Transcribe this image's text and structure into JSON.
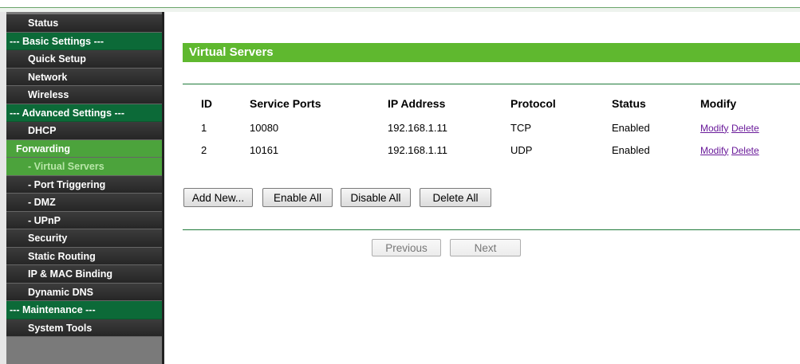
{
  "sidebar": {
    "items": [
      {
        "label": "Status",
        "kind": "item"
      },
      {
        "label": "--- Basic Settings ---",
        "kind": "section"
      },
      {
        "label": "Quick Setup",
        "kind": "item"
      },
      {
        "label": "Network",
        "kind": "item"
      },
      {
        "label": "Wireless",
        "kind": "item"
      },
      {
        "label": "--- Advanced Settings ---",
        "kind": "section"
      },
      {
        "label": "DHCP",
        "kind": "item"
      },
      {
        "label": "Forwarding",
        "kind": "active"
      },
      {
        "label": "- Virtual Servers",
        "kind": "current"
      },
      {
        "label": "- Port Triggering",
        "kind": "item"
      },
      {
        "label": "- DMZ",
        "kind": "item"
      },
      {
        "label": "- UPnP",
        "kind": "item"
      },
      {
        "label": "Security",
        "kind": "item"
      },
      {
        "label": "Static Routing",
        "kind": "item"
      },
      {
        "label": "IP & MAC Binding",
        "kind": "item"
      },
      {
        "label": "Dynamic DNS",
        "kind": "item"
      },
      {
        "label": "--- Maintenance ---",
        "kind": "section"
      },
      {
        "label": "System Tools",
        "kind": "item"
      }
    ]
  },
  "page": {
    "title": "Virtual Servers"
  },
  "table": {
    "headers": [
      "ID",
      "Service Ports",
      "IP Address",
      "Protocol",
      "Status",
      "Modify"
    ],
    "rows": [
      {
        "id": "1",
        "port": "10080",
        "ip": "192.168.1.11",
        "protocol": "TCP",
        "status": "Enabled",
        "modify": "Modify",
        "delete": "Delete"
      },
      {
        "id": "2",
        "port": "10161",
        "ip": "192.168.1.11",
        "protocol": "UDP",
        "status": "Enabled",
        "modify": "Modify",
        "delete": "Delete"
      }
    ]
  },
  "actions": {
    "add_new": "Add New...",
    "enable_all": "Enable All",
    "disable_all": "Disable All",
    "delete_all": "Delete All"
  },
  "pagination": {
    "previous": "Previous",
    "next": "Next"
  },
  "colors": {
    "title_bar": "#5fb82f",
    "section": "#0c6a38",
    "active": "#4ca33c",
    "link": "#6a1b9a"
  }
}
